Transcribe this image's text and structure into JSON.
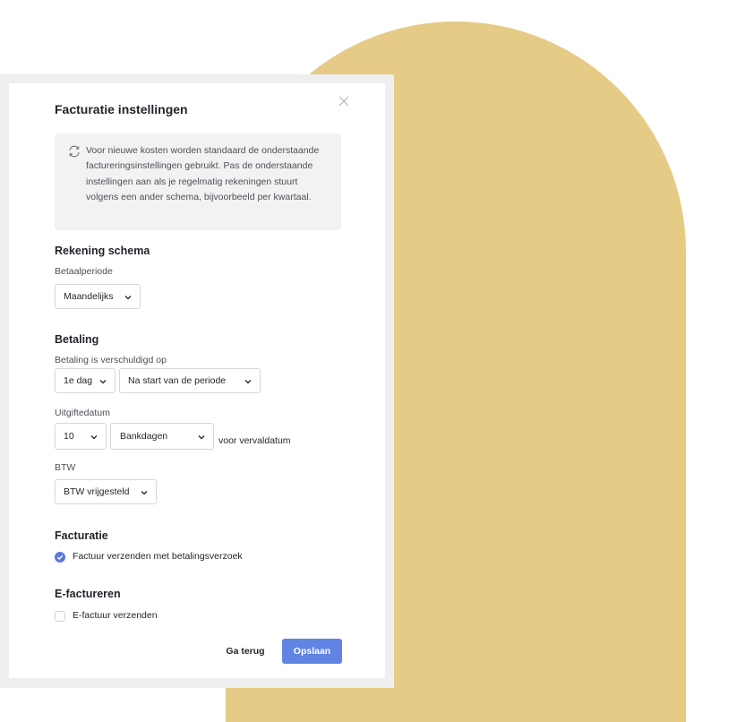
{
  "modal": {
    "title": "Facturatie instellingen",
    "info_text": "Voor nieuwe kosten worden standaard de onderstaande factureringsinstellingen gebruikt. Pas de onderstaande instellingen aan als je regelmatig rekeningen stuurt volgens een ander schema, bijvoorbeeld per kwartaal."
  },
  "schedule": {
    "heading": "Rekening schema",
    "period_label": "Betaalperiode",
    "period_value": "Maandelijks"
  },
  "payment": {
    "heading": "Betaling",
    "due_label": "Betaling is verschuldigd op",
    "due_day": "1e dag",
    "due_relative": "Na start van de periode",
    "issue_label": "Uitgiftedatum",
    "issue_count": "10",
    "issue_unit": "Bankdagen",
    "issue_suffix": "voor vervaldatum",
    "vat_label": "BTW",
    "vat_value": "BTW vrijgesteld"
  },
  "invoicing": {
    "heading": "Facturatie",
    "send_with_request_label": "Factuur verzenden met betalingsverzoek",
    "send_with_request_checked": true
  },
  "einvoicing": {
    "heading": "E-factureren",
    "send_einvoice_label": "E-factuur verzenden",
    "send_einvoice_checked": false
  },
  "actions": {
    "back_label": "Ga terug",
    "save_label": "Opslaan"
  },
  "colors": {
    "accent": "#6184e4",
    "background_arch": "#e6cb86",
    "info_bg": "#f2f2f2"
  },
  "icons": [
    "close-icon",
    "refresh-icon",
    "chevron-down-icon",
    "checkmark-icon"
  ]
}
